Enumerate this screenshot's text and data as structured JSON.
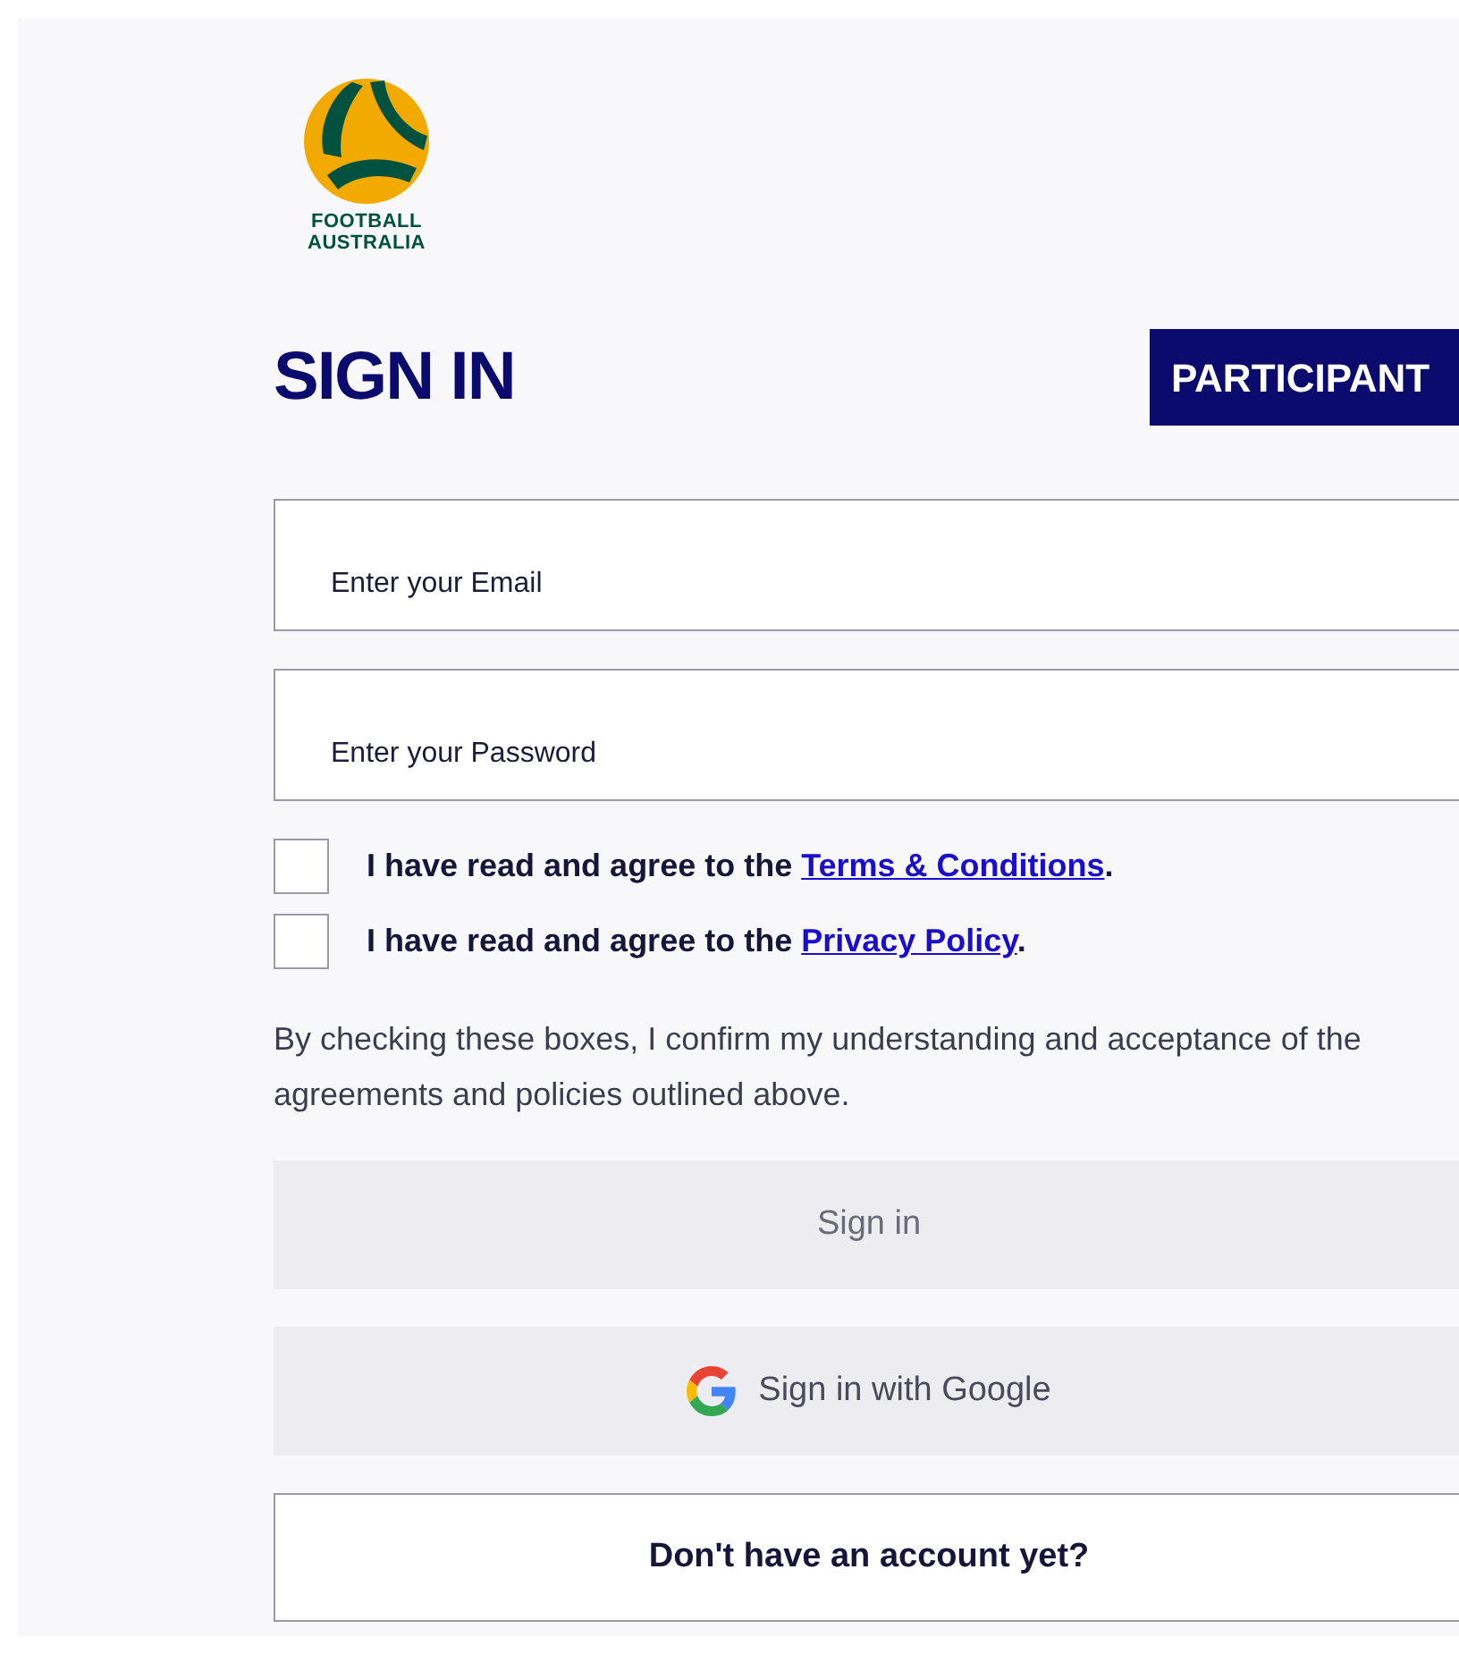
{
  "logo": {
    "lines": [
      "FOOTBALL",
      "AUSTRALIA"
    ]
  },
  "heading": "SIGN IN",
  "badge": "PARTICIPANT",
  "fields": [
    {
      "placeholder": "Enter your Email"
    },
    {
      "placeholder": "Enter your Password"
    }
  ],
  "agreements": [
    {
      "text": "I have read and agree to the",
      "link": "Terms & Conditions",
      "after": ".",
      "checked": false
    },
    {
      "text": "I have read and agree to the",
      "link": "Privacy Policy",
      "after": ".",
      "checked": false
    }
  ],
  "note": "By checking these boxes, I confirm my understanding and acceptance of the agreements and policies outlined above.",
  "buttons": [
    {
      "kind": "primary",
      "label": "Sign in",
      "disabled": true
    },
    {
      "kind": "google",
      "label": "Sign in with Google",
      "disabled": false
    },
    {
      "kind": "outline",
      "label": "Don't have an account yet?",
      "disabled": false
    }
  ]
}
